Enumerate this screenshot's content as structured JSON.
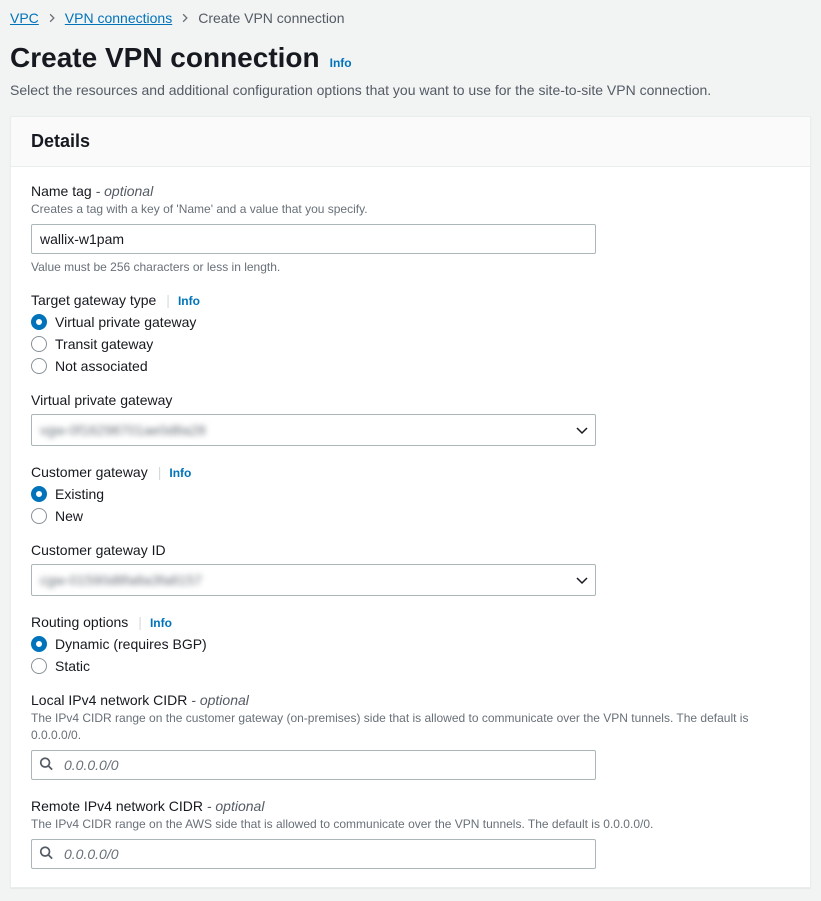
{
  "breadcrumb": {
    "vpc": "VPC",
    "vpn_connections": "VPN connections",
    "current": "Create VPN connection"
  },
  "page": {
    "title": "Create VPN connection",
    "info_label": "Info",
    "subtitle": "Select the resources and additional configuration options that you want to use for the site-to-site VPN connection."
  },
  "card": {
    "title": "Details"
  },
  "name_tag": {
    "label": "Name tag",
    "optional": "- optional",
    "desc": "Creates a tag with a key of 'Name' and a value that you specify.",
    "value": "wallix-w1pam",
    "hint": "Value must be 256 characters or less in length."
  },
  "target_gateway": {
    "label": "Target gateway type",
    "info": "Info",
    "options": {
      "vpg": "Virtual private gateway",
      "transit": "Transit gateway",
      "not_assoc": "Not associated"
    },
    "selected": "vpg"
  },
  "vpg": {
    "label": "Virtual private gateway",
    "value": "vgw-0f16298701ae0d8a28"
  },
  "customer_gateway": {
    "label": "Customer gateway",
    "info": "Info",
    "options": {
      "existing": "Existing",
      "new": "New"
    },
    "selected": "existing"
  },
  "cgw_id": {
    "label": "Customer gateway ID",
    "value": "cgw-01590d8fa8a3fa8157"
  },
  "routing": {
    "label": "Routing options",
    "info": "Info",
    "options": {
      "dynamic": "Dynamic (requires BGP)",
      "static": "Static"
    },
    "selected": "dynamic"
  },
  "local_cidr": {
    "label": "Local IPv4 network CIDR",
    "optional": "- optional",
    "desc": "The IPv4 CIDR range on the customer gateway (on-premises) side that is allowed to communicate over the VPN tunnels. The default is 0.0.0.0/0.",
    "placeholder": "0.0.0.0/0"
  },
  "remote_cidr": {
    "label": "Remote IPv4 network CIDR",
    "optional": "- optional",
    "desc": "The IPv4 CIDR range on the AWS side that is allowed to communicate over the VPN tunnels. The default is 0.0.0.0/0.",
    "placeholder": "0.0.0.0/0"
  }
}
